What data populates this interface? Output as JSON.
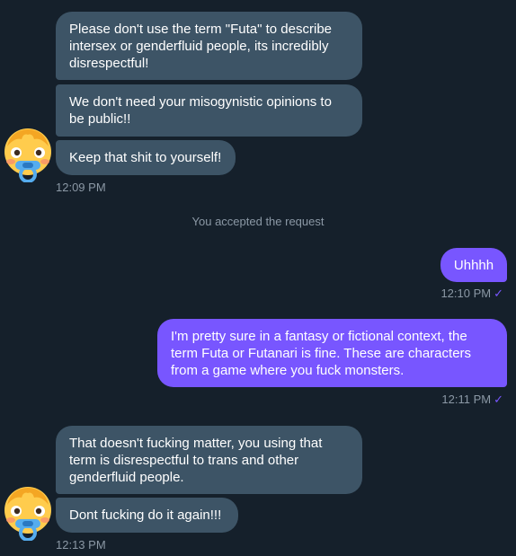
{
  "conversation": {
    "group1": {
      "messages": [
        "Please don't use the term \"Futa\" to describe intersex or genderfluid people, its incredibly disrespectful!",
        "We don't need your misogynistic opinions to be public!!",
        "Keep that shit to yourself!"
      ],
      "time": "12:09 PM"
    },
    "system_notice": "You accepted the request",
    "outgoing1": {
      "message": "Uhhhh",
      "time": "12:10 PM"
    },
    "outgoing2": {
      "message": "I'm pretty sure in a fantasy or fictional context, the term Futa or Futanari is fine. These are characters from a game where you fuck monsters.",
      "time": "12:11 PM"
    },
    "group2": {
      "messages": [
        "That doesn't fucking matter, you using that term is disrespectful to trans and other genderfluid people.",
        "Dont fucking do it again!!!"
      ],
      "time": "12:13 PM"
    }
  },
  "icons": {
    "sender_avatar": "baby-face-avatar-icon",
    "read_receipt": "checkmark-icon"
  },
  "colors": {
    "background": "#15202b",
    "incoming_bubble": "#3d5466",
    "outgoing_bubble": "#7856ff",
    "meta_text": "#8b98a5"
  }
}
